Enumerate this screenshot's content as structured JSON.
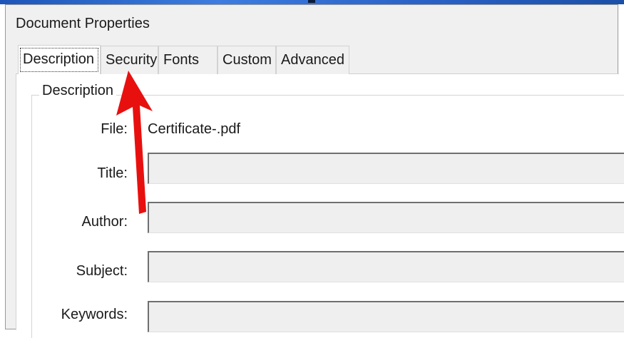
{
  "window": {
    "title": "Document Properties"
  },
  "tabs": [
    {
      "label": "Description",
      "active": true
    },
    {
      "label": "Security",
      "active": false
    },
    {
      "label": "Fonts",
      "active": false
    },
    {
      "label": "Custom",
      "active": false
    },
    {
      "label": "Advanced",
      "active": false
    }
  ],
  "description": {
    "group_label": "Description",
    "file_label": "File:",
    "file_value": "Certificate-.pdf",
    "title_label": "Title:",
    "title_value": "",
    "author_label": "Author:",
    "author_value": "",
    "subject_label": "Subject:",
    "subject_value": "",
    "keywords_label": "Keywords:",
    "keywords_value": ""
  },
  "annotation": {
    "arrow_color": "#e8100f",
    "arrow_target": "tab-security"
  }
}
